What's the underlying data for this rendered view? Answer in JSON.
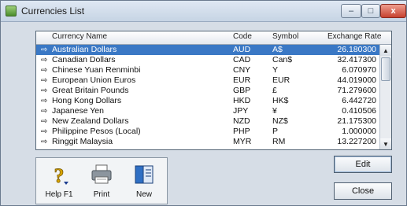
{
  "window": {
    "title": "Currencies List",
    "controls": {
      "minimize": "–",
      "maximize": "□",
      "close": "x"
    }
  },
  "grid": {
    "headers": {
      "name": "Currency Name",
      "code": "Code",
      "symbol": "Symbol",
      "rate": "Exchange Rate"
    },
    "rows": [
      {
        "arrow": "⇨",
        "name": "Australian Dollars",
        "code": "AUD",
        "symbol": "A$",
        "rate": "26.180300"
      },
      {
        "arrow": "⇨",
        "name": "Canadian Dollars",
        "code": "CAD",
        "symbol": "Can$",
        "rate": "32.417300"
      },
      {
        "arrow": "⇨",
        "name": "Chinese Yuan Renminbi",
        "code": "CNY",
        "symbol": "Y",
        "rate": "6.070970"
      },
      {
        "arrow": "⇨",
        "name": "European Union Euros",
        "code": "EUR",
        "symbol": "EUR",
        "rate": "44.019000"
      },
      {
        "arrow": "⇨",
        "name": "Great Britain Pounds",
        "code": "GBP",
        "symbol": "£",
        "rate": "71.279600"
      },
      {
        "arrow": "⇨",
        "name": "Hong Kong Dollars",
        "code": "HKD",
        "symbol": "HK$",
        "rate": "6.442720"
      },
      {
        "arrow": "⇨",
        "name": "Japanese Yen",
        "code": "JPY",
        "symbol": "¥",
        "rate": "0.410506"
      },
      {
        "arrow": "⇨",
        "name": "New Zealand Dollars",
        "code": "NZD",
        "symbol": "NZ$",
        "rate": "21.175300"
      },
      {
        "arrow": "⇨",
        "name": "Philippine Pesos (Local)",
        "code": "PHP",
        "symbol": "P",
        "rate": "1.000000"
      },
      {
        "arrow": "⇨",
        "name": "Ringgit Malaysia",
        "code": "MYR",
        "symbol": "RM",
        "rate": "13.227200"
      }
    ],
    "selected_index": 0,
    "scroll": {
      "up": "▲",
      "down": "▼"
    }
  },
  "toolbar": {
    "help_label": "Help F1",
    "print_label": "Print",
    "new_label": "New"
  },
  "actions": {
    "edit_label": "Edit",
    "close_label": "Close"
  },
  "colors": {
    "selection": "#3a78c5",
    "window_bg": "#d6dde6"
  }
}
